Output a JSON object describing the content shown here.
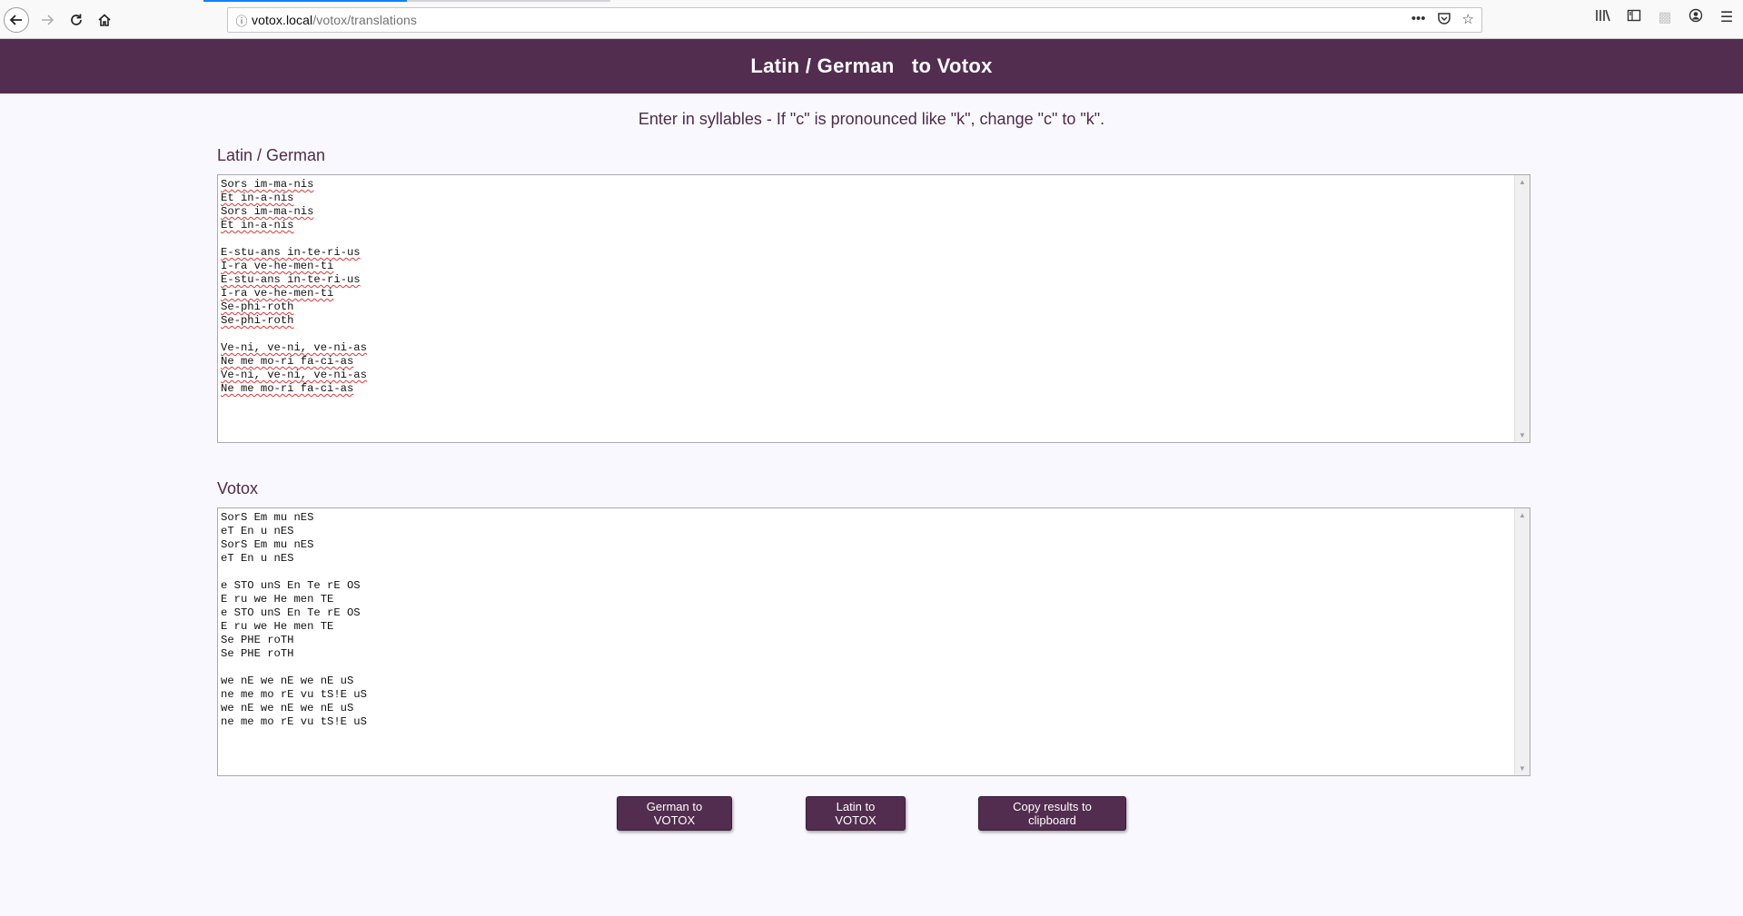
{
  "browser": {
    "url_host": "votox.local",
    "url_path": "/votox/translations",
    "icons": {
      "back": "back-arrow-icon",
      "forward": "forward-arrow-icon",
      "reload": "reload-icon",
      "home": "home-icon",
      "info": "info-icon",
      "more": "more-dots-icon",
      "pocket": "pocket-icon",
      "bookmark": "bookmark-star-icon",
      "library": "library-icon",
      "sidebar": "sidebar-icon",
      "extension": "extension-icon",
      "account": "account-icon",
      "menu": "hamburger-menu-icon"
    }
  },
  "header": {
    "title": "Latin / German   to Votox"
  },
  "instruction": "Enter in syllables - If \"c\" is pronounced like \"k\", change \"c\" to \"k\".",
  "input": {
    "label": "Latin / German",
    "value": "Sors im-ma-nis\nEt in-a-nis\nSors im-ma-nis\nEt in-a-nis\n\nE-stu-ans in-te-ri-us\nI-ra ve-he-men-ti\nE-stu-ans in-te-ri-us\nI-ra ve-he-men-ti\nSe-phi-roth\nSe-phi-roth\n\nVe-ni, ve-ni, ve-ni-as\nNe me mo-ri fa-ci-as\nVe-ni, ve-ni, ve-ni-as\nNe me mo-ri fa-ci-as"
  },
  "output": {
    "label": "Votox",
    "value": "SorS Em mu nES\neT En u nES\nSorS Em mu nES\neT En u nES\n\ne STO unS En Te rE OS\nE ru we He men TE\ne STO unS En Te rE OS\nE ru we He men TE\nSe PHE roTH\nSe PHE roTH\n\nwe nE we nE we nE uS\nne me mo rE vu tS!E uS\nwe nE we nE we nE uS\nne me mo rE vu tS!E uS"
  },
  "buttons": {
    "german_to_votox": "German to VOTOX",
    "latin_to_votox": "Latin to VOTOX",
    "copy_results": "Copy results to clipboard"
  },
  "colors": {
    "brand": "#522d4f",
    "page_background": "#f9f8fe"
  }
}
